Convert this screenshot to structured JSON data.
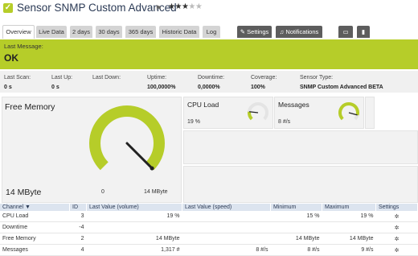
{
  "header": {
    "status_icon": "check-icon",
    "title": "Sensor SNMP Custom Advanced",
    "flag_icon": "flag-icon",
    "rating": 3,
    "rating_max": 5
  },
  "tabs": [
    {
      "label": "Overview"
    },
    {
      "label": "Live Data"
    },
    {
      "label": "2 days"
    },
    {
      "label": "30 days"
    },
    {
      "label": "365 days"
    },
    {
      "label": "Historic Data"
    },
    {
      "label": "Log"
    },
    {
      "label": "Settings",
      "icon": "wrench-icon"
    },
    {
      "label": "Notifications",
      "icon": "bell-icon"
    }
  ],
  "toolbar_icons": [
    "comment-icon",
    "trash-icon"
  ],
  "status": {
    "last_message_label": "Last Message:",
    "value": "OK",
    "color": "#b6cd29"
  },
  "stats": [
    {
      "label": "Last Scan:",
      "value": "0 s"
    },
    {
      "label": "Last Up:",
      "value": "0 s"
    },
    {
      "label": "Last Down:",
      "value": ""
    },
    {
      "label": "Uptime:",
      "value": "100,0000%"
    },
    {
      "label": "Downtime:",
      "value": "0,0000%"
    },
    {
      "label": "Coverage:",
      "value": "100%"
    },
    {
      "label": "Sensor Type:",
      "value": "SNMP Custom Advanced BETA"
    }
  ],
  "gauges": {
    "primary": {
      "name": "Free Memory",
      "value": "14 MByte",
      "min": "0",
      "max": "14 MByte",
      "level": 1.0
    },
    "cpu": {
      "name": "CPU Load",
      "value": "19 %",
      "level": 0.19
    },
    "messages": {
      "name": "Messages",
      "value": "8 #/s",
      "level": 0.89
    }
  },
  "table": {
    "headers": [
      "Channel",
      "ID",
      "Last Value (volume)",
      "Last Value (speed)",
      "Minimum",
      "Maximum",
      "Settings"
    ],
    "rows": [
      {
        "channel": "CPU Load",
        "id": "3",
        "volume": "19 %",
        "speed": "",
        "min": "15 %",
        "max": "19 %"
      },
      {
        "channel": "Downtime",
        "id": "-4",
        "volume": "",
        "speed": "",
        "min": "",
        "max": ""
      },
      {
        "channel": "Free Memory",
        "id": "2",
        "volume": "14 MByte",
        "speed": "",
        "min": "14 MByte",
        "max": "14 MByte"
      },
      {
        "channel": "Messages",
        "id": "4",
        "volume": "1,317 #",
        "speed": "8 #/s",
        "min": "8 #/s",
        "max": "9 #/s"
      }
    ]
  }
}
